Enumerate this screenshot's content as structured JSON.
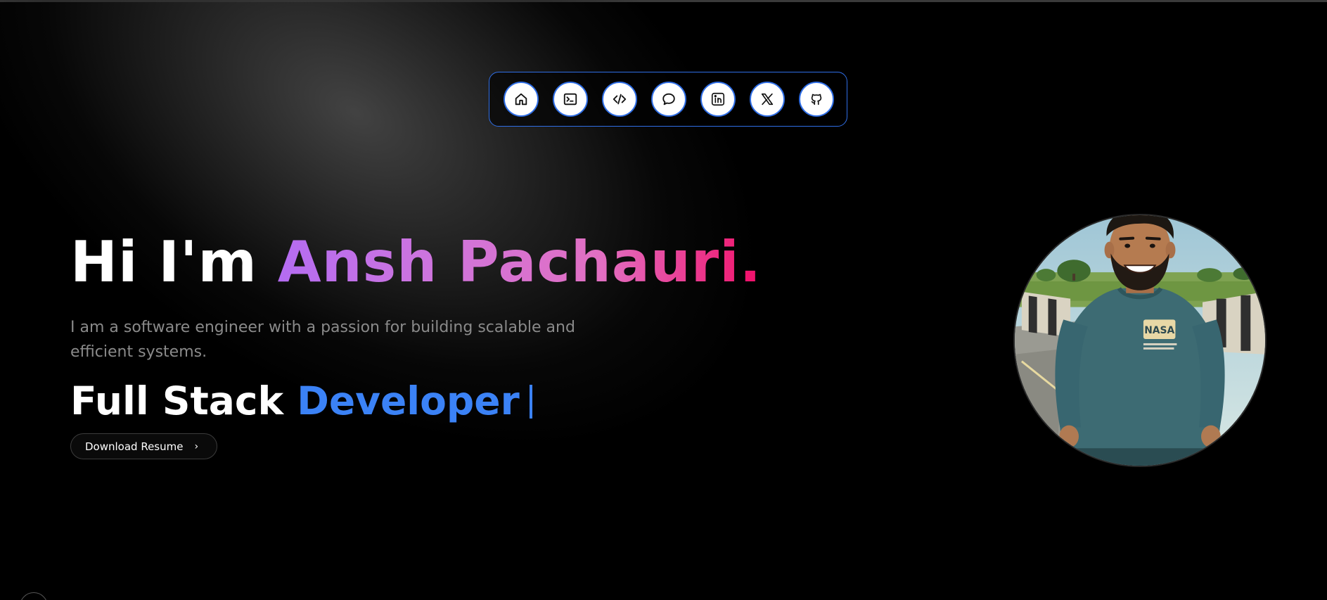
{
  "nav": {
    "items": [
      {
        "name": "home",
        "icon": "home-icon"
      },
      {
        "name": "terminal",
        "icon": "terminal-icon"
      },
      {
        "name": "code",
        "icon": "code-icon"
      },
      {
        "name": "chat",
        "icon": "chat-bubble-icon"
      },
      {
        "name": "linkedin",
        "icon": "linkedin-icon"
      },
      {
        "name": "x",
        "icon": "x-logo-icon"
      },
      {
        "name": "github",
        "icon": "github-icon"
      }
    ],
    "border_color": "#2f6ee6"
  },
  "hero": {
    "greeting": "Hi I'm ",
    "name": "Ansh Pachauri",
    "name_punct": ".",
    "subtitle": "I am a software engineer with a passion for building scalable and efficient systems.",
    "role_prefix": "Full Stack ",
    "role_highlight": "Developer",
    "resume_label": "Download Resume",
    "resume_chevron": "›"
  },
  "colors": {
    "name_gradient_start": "#b46cf2",
    "name_gradient_end": "#ef1f76",
    "role_highlight": "#3b82f6",
    "subtitle": "#8a8a8a"
  },
  "avatar": {
    "alt": "illustrated portrait of a smiling man in a teal NASA sweater",
    "shirt_text": "NASA"
  }
}
